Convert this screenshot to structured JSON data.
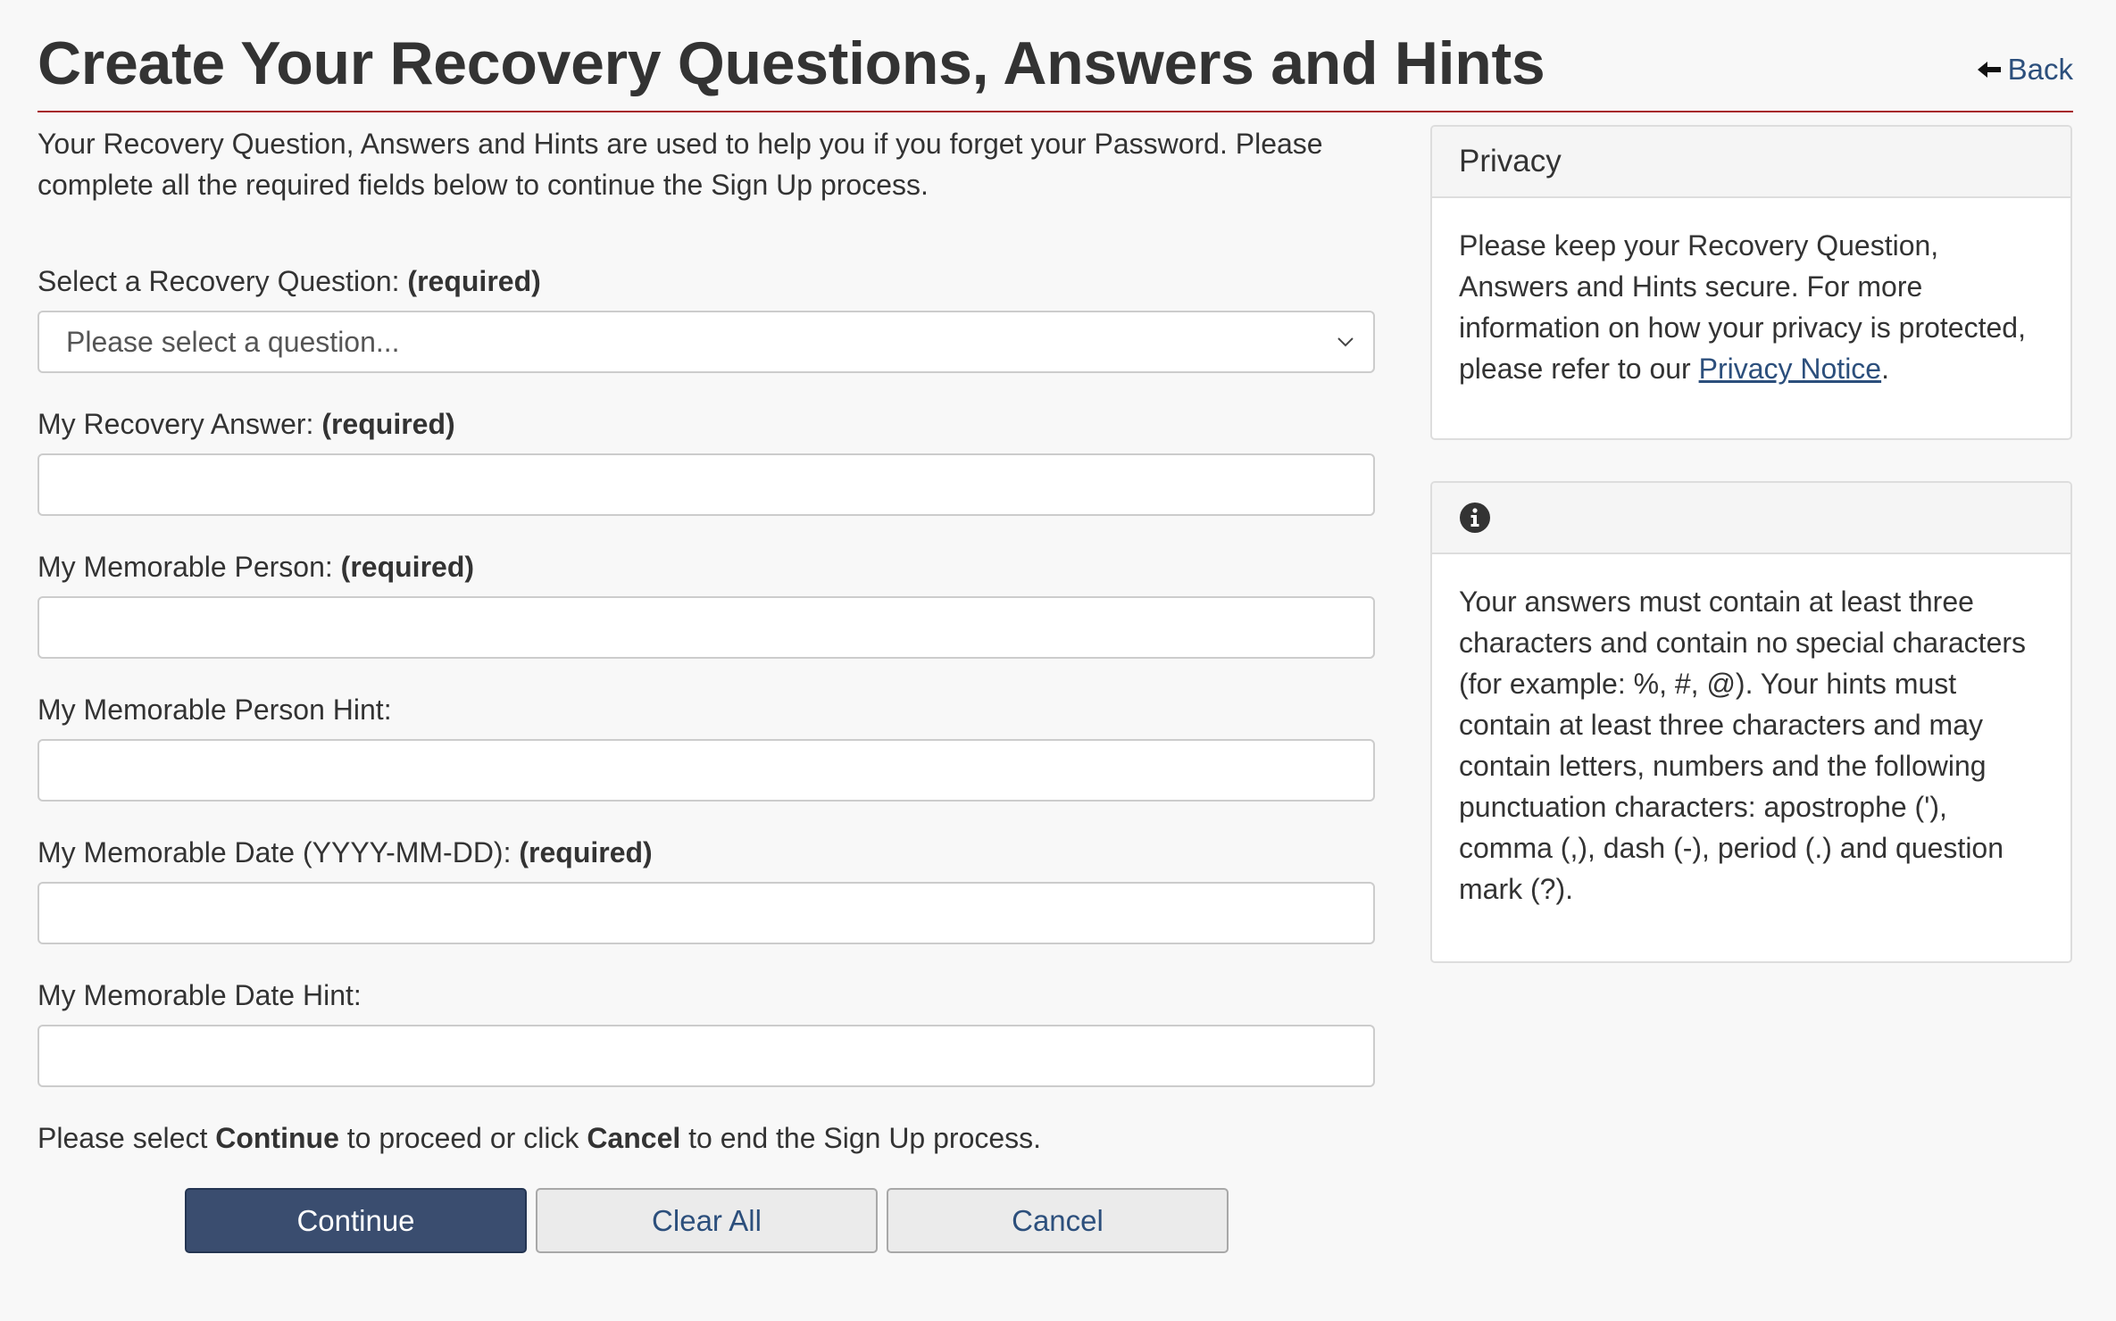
{
  "header": {
    "title": "Create Your Recovery Questions, Answers and Hints",
    "back_label": "Back"
  },
  "intro": "Your Recovery Question, Answers and Hints are used to help you if you forget your Password. Please complete all the required fields below to continue the Sign Up process.",
  "required_tag": "(required)",
  "form": {
    "question": {
      "label": "Select a Recovery Question:",
      "required": true,
      "selected": "Please select a question..."
    },
    "answer": {
      "label": "My Recovery Answer:",
      "required": true,
      "value": ""
    },
    "person": {
      "label": "My Memorable Person:",
      "required": true,
      "value": ""
    },
    "person_hint": {
      "label": "My Memorable Person Hint:",
      "required": false,
      "value": ""
    },
    "date": {
      "label": "My Memorable Date (YYYY-MM-DD):",
      "required": true,
      "value": ""
    },
    "date_hint": {
      "label": "My Memorable Date Hint:",
      "required": false,
      "value": ""
    }
  },
  "proceed": {
    "part1": "Please select ",
    "continue_word": "Continue",
    "part2": " to proceed or click ",
    "cancel_word": "Cancel",
    "part3": " to end the Sign Up process."
  },
  "buttons": {
    "continue": "Continue",
    "clear_all": "Clear All",
    "cancel": "Cancel"
  },
  "privacy_panel": {
    "heading": "Privacy",
    "text_before_link": "Please keep your Recovery Question, Answers and Hints secure. For more information on how your privacy is protected, please refer to our ",
    "link_text": "Privacy Notice",
    "text_after_link": "."
  },
  "info_panel": {
    "icon": "info-circle-icon",
    "text": "Your answers must contain at least three characters and contain no special characters (for example: %, #, @). Your hints must contain at least three characters and may contain letters, numbers and the following punctuation characters: apostrophe ('), comma (,), dash (-), period (.) and question mark (?)."
  },
  "colors": {
    "title_rule": "#a6262b",
    "primary_button": "#3a4d6f",
    "link": "#2c4f7c",
    "background": "#f8f8f8"
  }
}
